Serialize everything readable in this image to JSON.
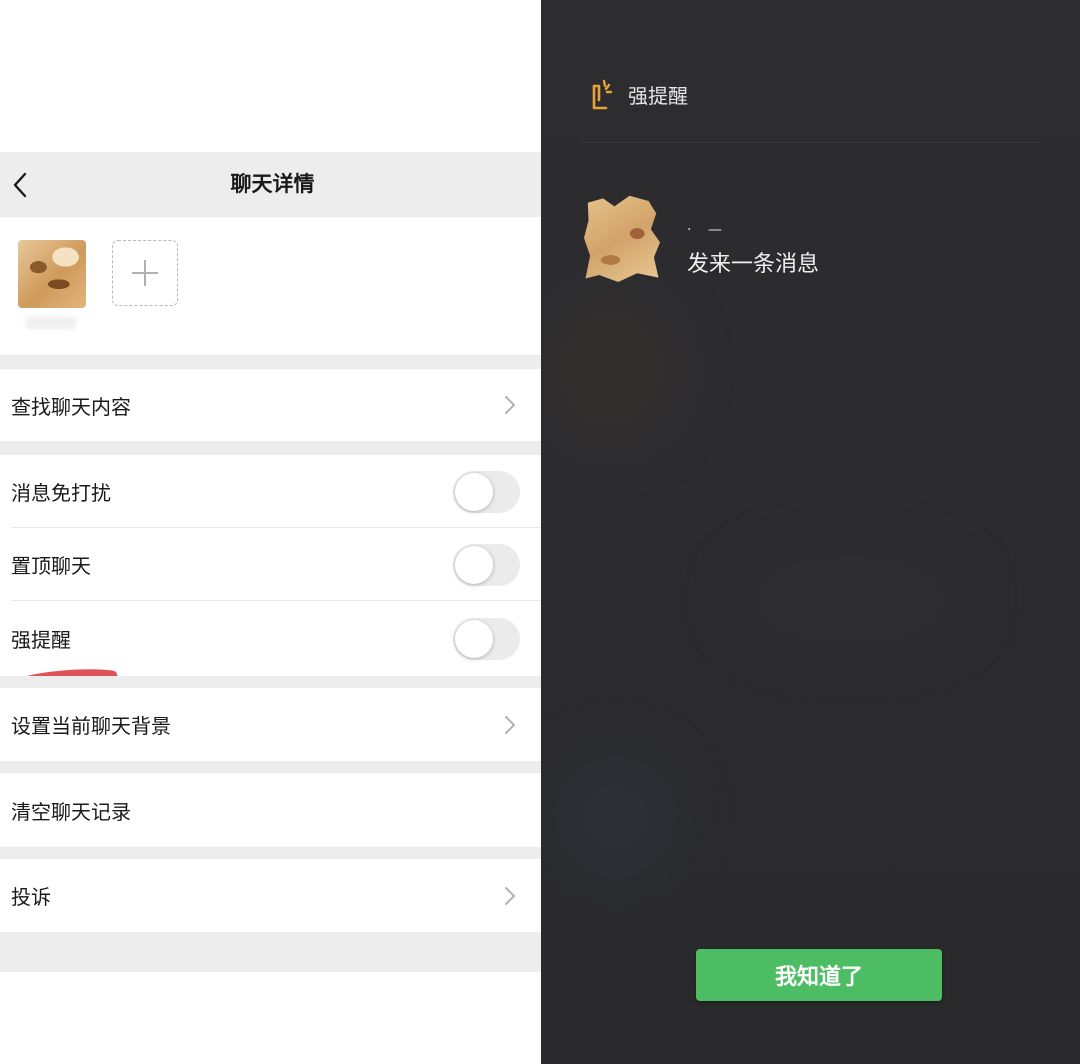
{
  "left_panel": {
    "nav": {
      "title": "聊天详情",
      "back_icon": "chevron-left-icon"
    },
    "members": {
      "add_icon": "plus-icon"
    },
    "items": {
      "search_chat": {
        "label": "查找聊天内容",
        "chevron_icon": "chevron-right-icon"
      },
      "mute": {
        "label": "消息免打扰",
        "on": false
      },
      "pin": {
        "label": "置顶聊天",
        "on": false
      },
      "strong_reminder": {
        "label": "强提醒",
        "on": false
      },
      "set_background": {
        "label": "设置当前聊天背景",
        "chevron_icon": "chevron-right-icon"
      },
      "clear_history": {
        "label": "清空聊天记录"
      },
      "report": {
        "label": "投诉",
        "chevron_icon": "chevron-right-icon"
      }
    },
    "colors": {
      "annotation_mark": "#e0525a",
      "toggle_off": "#ebebeb",
      "group_bg": "#ededed"
    }
  },
  "right_panel": {
    "header": {
      "title": "强提醒",
      "icon": "reminder-tap-icon",
      "icon_color": "#e8a23a"
    },
    "notification": {
      "sender": "·  —",
      "message": "发来一条消息"
    },
    "button": {
      "label": "我知道了",
      "color": "#4dbd63"
    }
  }
}
